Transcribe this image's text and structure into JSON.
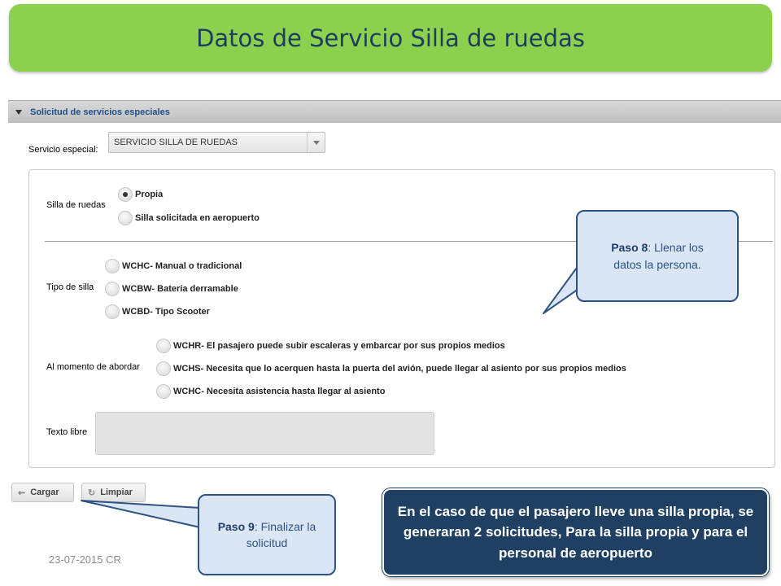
{
  "title": "Datos de Servicio Silla de ruedas",
  "section": {
    "header": "Solicitud de servicios especiales"
  },
  "service_field": {
    "label": "Servicio especial:",
    "value": "SERVICIO SILLA DE RUEDAS"
  },
  "wheelchair": {
    "label": "Silla de ruedas",
    "options": [
      "Propia",
      "Silla solicitada en aeropuerto"
    ],
    "selected": "Propia"
  },
  "chair_type": {
    "label": "Tipo de silla",
    "options": [
      "WCHC- Manual o tradicional",
      "WCBW- Batería derramable",
      "WCBD- Tipo Scooter"
    ]
  },
  "boarding": {
    "label": "Al momento de abordar",
    "options": [
      "WCHR- El pasajero puede subir escaleras y embarcar por sus propios medios",
      "WCHS- Necesita que lo acerquen hasta la puerta del avión, puede llegar al asiento por sus propios medios",
      "WCHC- Necesita asistencia hasta llegar al asiento"
    ]
  },
  "free_text": {
    "label": "Texto libre",
    "value": ""
  },
  "buttons": {
    "load": "Cargar",
    "clear": "Limpiar"
  },
  "callout_step8": {
    "step": "Paso 8",
    "text": ": Llenar los datos la persona."
  },
  "callout_step9": {
    "step": "Paso 9",
    "text": ": Finalizar la solicitud"
  },
  "note": "En el caso de que el pasajero lleve una silla propia, se generaran 2 solicitudes, Para la silla propia y para el personal de aeropuerto",
  "footer_date": "23-07-2015 CR",
  "colors": {
    "banner": "#8bd14d",
    "title_text": "#1f3c5e",
    "callout_bg": "#dbe6f4",
    "callout_border": "#2e5380",
    "note_bg": "#1f3f63"
  }
}
